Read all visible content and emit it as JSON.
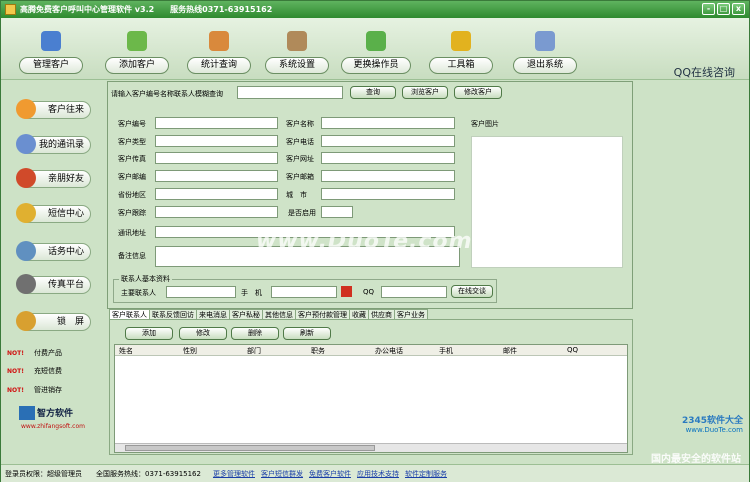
{
  "window": {
    "title": "高腾免费客户呼叫中心管理软件 v3.2",
    "hotline": "服务热线0371-63915162",
    "buttons": [
      "-",
      "□",
      "x"
    ]
  },
  "toolbar": {
    "items": [
      {
        "label": "管理客户",
        "icon": "user-icon",
        "color": "#4a7fd0"
      },
      {
        "label": "添加客户",
        "icon": "add-customer-icon",
        "color": "#6cb84a"
      },
      {
        "label": "统计查询",
        "icon": "chart-icon",
        "color": "#d9893c"
      },
      {
        "label": "系统设置",
        "icon": "tools-icon",
        "color": "#b08a5a"
      },
      {
        "label": "更换操作员",
        "icon": "operators-icon",
        "color": "#5ab04a"
      },
      {
        "label": "工具箱",
        "icon": "folder-icon",
        "color": "#e2b21f"
      },
      {
        "label": "退出系统",
        "icon": "exit-icon",
        "color": "#7a9ad0"
      }
    ],
    "qq": "QQ在线咨询"
  },
  "sidebar": {
    "items": [
      {
        "label": "客户往来",
        "icon": "phone-icon",
        "color": "#f09a30"
      },
      {
        "label": "我的通讯录",
        "icon": "contacts-icon",
        "color": "#6a8fd0"
      },
      {
        "label": "亲朋好友",
        "icon": "friends-icon",
        "color": "#d04a2a"
      },
      {
        "label": "短信中心",
        "icon": "sms-icon",
        "color": "#e0b030"
      },
      {
        "label": "话务中心",
        "icon": "call-icon",
        "color": "#6090c0"
      },
      {
        "label": "传真平台",
        "icon": "fax-icon",
        "color": "#707070"
      },
      {
        "label": "锁　屏",
        "icon": "lock-icon",
        "color": "#d8a030"
      }
    ],
    "hot_tag": "NOT!",
    "hot_items": [
      "付费产品",
      "充短信费",
      "管进销存"
    ],
    "logo_text": "智方软件",
    "logo_url": "www.zhifangsoft.com"
  },
  "search": {
    "label": "请输入客户编号名称联系人模糊查询",
    "value": "",
    "buttons": [
      "查询",
      "浏览客户",
      "修改客户"
    ]
  },
  "form": {
    "photo_label": "客户图片",
    "left_fields": [
      "客户编号",
      "客户类型",
      "客户传真",
      "客户邮编",
      "省份地区",
      "客户跟踪"
    ],
    "right_fields": [
      "客户名称",
      "客户电话",
      "客户网址",
      "客户邮箱",
      "城　市",
      "是否启用"
    ],
    "address_label": "通讯地址",
    "remark_label": "备注信息"
  },
  "contact_group": {
    "title": "联系人基本资料",
    "main_contact": "主要联系人",
    "mobile": "手　机",
    "qq": "QQ",
    "button": "在线交谈"
  },
  "tabs": [
    "客户联系人",
    "联系反馈回访",
    "来电消息",
    "客户私秘",
    "其他信息",
    "客户预付款管理",
    "收藏",
    "供应商",
    "客户业务"
  ],
  "panel_buttons": [
    "添加",
    "修改",
    "删除",
    "刷新"
  ],
  "grid": {
    "columns": [
      "姓名",
      "性别",
      "部门",
      "职务",
      "办公电话",
      "手机",
      "邮件",
      "QQ"
    ]
  },
  "statusbar": {
    "login": "登录员权限：",
    "role": "超级管理员",
    "hotline": "全国服务热线：0371-63915162",
    "links": [
      "更多管理软件",
      "客户短信群发",
      "免费客户软件",
      "应用技术支持",
      "软件定制服务"
    ]
  },
  "watermarks": {
    "duote": "www.DuoTe.com",
    "site": "2345软件大全",
    "site_url": "www.DuoTe.com",
    "slogan": "国内最安全的软件站"
  }
}
